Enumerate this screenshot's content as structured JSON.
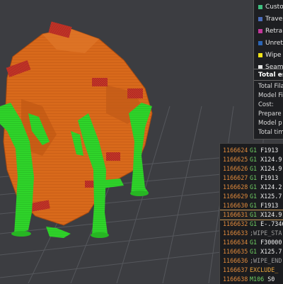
{
  "legend": {
    "items": [
      {
        "label": "Custo",
        "color": "#3fbf7f"
      },
      {
        "label": "Trave",
        "color": "#4a6bb8"
      },
      {
        "label": "Retra",
        "color": "#c2379a"
      },
      {
        "label": "Unret",
        "color": "#2b65b5"
      },
      {
        "label": "Wipe",
        "color": "#f1e318"
      },
      {
        "label": "Seam",
        "color": "#e6e6e6"
      }
    ],
    "stats_header": "Total est",
    "stats": [
      "Total Fila",
      "Model Fil",
      "Cost:",
      "Prepare",
      "Model p",
      "Total tim"
    ]
  },
  "gcode": {
    "lines": [
      {
        "num": "1166624",
        "cmd": "G1",
        "args": "F1913"
      },
      {
        "num": "1166625",
        "cmd": "G1",
        "args": "X124.9"
      },
      {
        "num": "1166626",
        "cmd": "G1",
        "args": "X124.9"
      },
      {
        "num": "1166627",
        "cmd": "G1",
        "args": "F1913"
      },
      {
        "num": "1166628",
        "cmd": "G1",
        "args": "X124.2"
      },
      {
        "num": "1166629",
        "cmd": "G1",
        "args": "X125.7"
      },
      {
        "num": "1166630",
        "cmd": "G1",
        "args": "F1913"
      },
      {
        "num": "1166631",
        "cmd": "G1",
        "args": "X124.9",
        "active": true
      },
      {
        "num": "1166632",
        "cmd": "G1",
        "args": "E-.7346"
      },
      {
        "num": "1166633",
        "cmd": "",
        "args": ";WIPE_STA",
        "comment": true
      },
      {
        "num": "1166634",
        "cmd": "G1",
        "args": "F30000"
      },
      {
        "num": "1166635",
        "cmd": "G1",
        "args": "X125.7"
      },
      {
        "num": "1166636",
        "cmd": "",
        "args": ";WIPE_END",
        "comment": true
      },
      {
        "num": "1166637",
        "cmd": "",
        "args": "EXCLUDE_",
        "macro": true
      },
      {
        "num": "1166638",
        "cmd": "M106",
        "args": "S0"
      }
    ]
  }
}
